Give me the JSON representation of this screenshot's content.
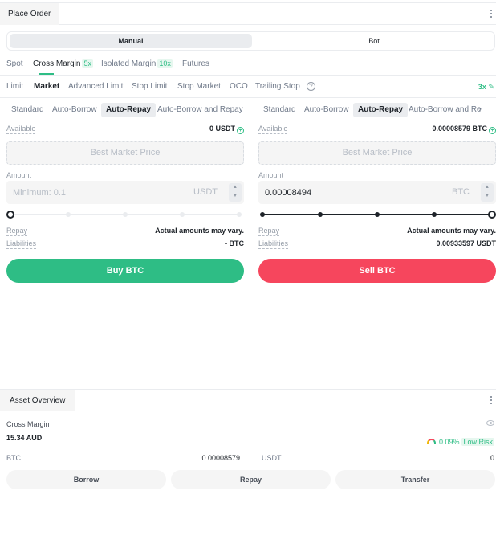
{
  "place_order": {
    "tab_label": "Place Order",
    "modes": {
      "manual": "Manual",
      "bot": "Bot"
    },
    "markets": [
      {
        "label": "Spot",
        "badge": ""
      },
      {
        "label": "Cross Margin",
        "badge": "5x"
      },
      {
        "label": "Isolated Margin",
        "badge": "10x"
      },
      {
        "label": "Futures",
        "badge": ""
      }
    ],
    "order_types": [
      "Limit",
      "Market",
      "Advanced Limit",
      "Stop Limit",
      "Stop Market",
      "OCO",
      "Trailing Stop"
    ],
    "active_order_type": "Market",
    "help_icon": "question-circle-icon",
    "leverage": "3x",
    "buy": {
      "modes": [
        "Standard",
        "Auto-Borrow",
        "Auto-Repay",
        "Auto-Borrow and Repay"
      ],
      "active_mode": "Auto-Repay",
      "available_label": "Available",
      "available_value": "0 USDT",
      "price_placeholder": "Best Market Price",
      "amount_label": "Amount",
      "amount_value": "",
      "amount_placeholder": "Minimum: 0.1",
      "amount_unit": "USDT",
      "slider_percent": 0,
      "repay_label": "Repay",
      "repay_value": "Actual amounts may vary.",
      "liabilities_label": "Liabilities",
      "liabilities_value": "- BTC",
      "button_label": "Buy BTC"
    },
    "sell": {
      "modes": [
        "Standard",
        "Auto-Borrow",
        "Auto-Repay",
        "Auto-Borrow and Re"
      ],
      "active_mode": "Auto-Repay",
      "available_label": "Available",
      "available_value": "0.00008579 BTC",
      "price_placeholder": "Best Market Price",
      "amount_label": "Amount",
      "amount_value": "0.00008494",
      "amount_placeholder": "",
      "amount_unit": "BTC",
      "slider_percent": 100,
      "repay_label": "Repay",
      "repay_value": "Actual amounts may vary.",
      "liabilities_label": "Liabilities",
      "liabilities_value": "0.00933597 USDT",
      "button_label": "Sell BTC"
    }
  },
  "asset_overview": {
    "tab_label": "Asset Overview",
    "account_label": "Cross Margin",
    "account_value": "15.34 AUD",
    "risk_ratio": "0.09%",
    "risk_level": "Low Risk",
    "balances": [
      {
        "asset": "BTC",
        "amount": "0.00008579"
      },
      {
        "asset": "USDT",
        "amount": "0"
      }
    ],
    "buttons": [
      "Borrow",
      "Repay",
      "Transfer"
    ]
  },
  "colors": {
    "buy": "#2ebd85",
    "sell": "#f6465d",
    "accent": "#2ebd85"
  }
}
